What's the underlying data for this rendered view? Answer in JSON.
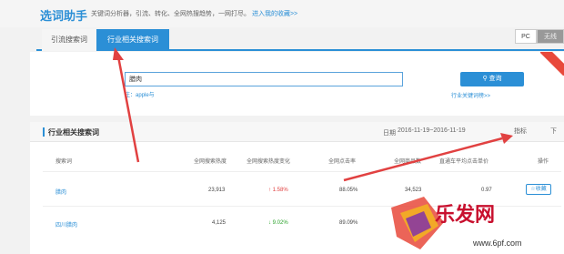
{
  "header": {
    "title": "选词助手",
    "description": "关键词分析器，引流、转化、全网热搜趋势，一网打尽。",
    "favorite_link": "进入我的收藏>>"
  },
  "tabs": [
    {
      "label": "引流搜索词",
      "active": false
    },
    {
      "label": "行业相关搜索词",
      "active": true
    }
  ],
  "device_toggle": {
    "pc": "PC",
    "wireless": "无线"
  },
  "search": {
    "value": "腊肉",
    "button_label": "查询",
    "hint": "注：apple与",
    "industry_link": "行业关键词榜>>"
  },
  "results": {
    "title": "行业相关搜索词",
    "date_label": "日期",
    "date_range": "2016-11-19~2016-11-19",
    "metric_button": "指标",
    "more_button": "下",
    "columns": [
      "搜索词",
      "全网搜索热度",
      "全网搜索热度变化",
      "全网点击率",
      "全网商品数",
      "直通车平均点击单价",
      "操作"
    ],
    "rows": [
      {
        "keyword": "腊肉",
        "heat": "23,913",
        "heat_change": "1.58%",
        "change_dir": "up",
        "ctr": "88.05%",
        "goods": "34,523",
        "cpc": "0.97",
        "action": "收藏"
      },
      {
        "keyword": "四川腊肉",
        "heat": "4,125",
        "heat_change": "9.02%",
        "change_dir": "down",
        "ctr": "89.09%",
        "goods": "",
        "cpc": "",
        "action": ""
      }
    ]
  },
  "watermark": {
    "brand": "乐发网",
    "url": "www.6pf.com"
  },
  "colors": {
    "accent": "#2b8fd6",
    "arrow": "#e14141",
    "up": "#e14141",
    "down": "#2aa22a",
    "ribbon": "#e8493b"
  }
}
